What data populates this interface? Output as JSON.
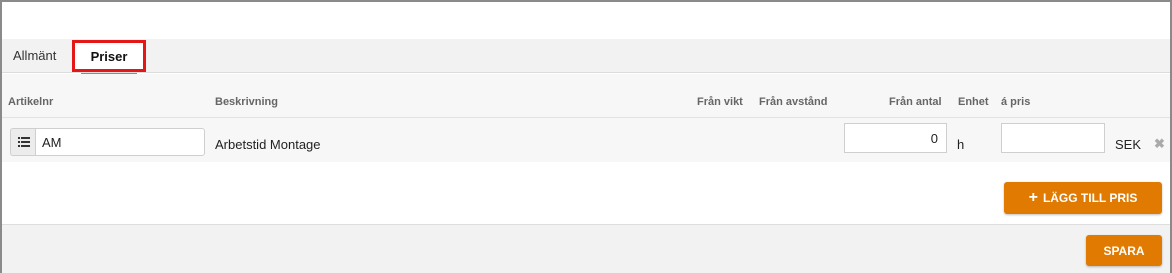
{
  "tabs": [
    {
      "label": "Allmänt",
      "active": false
    },
    {
      "label": "Priser",
      "active": true
    }
  ],
  "table": {
    "columns": [
      "Artikelnr",
      "Beskrivning",
      "Från vikt",
      "Från avstånd",
      "Från antal",
      "Enhet",
      "á pris"
    ],
    "rows": [
      {
        "article_nr": "AM",
        "description": "Arbetstid Montage",
        "from_quantity": "0",
        "unit": "h",
        "price": "",
        "currency": "SEK"
      }
    ]
  },
  "icons": {
    "list": "list-icon",
    "delete": "close-icon",
    "add": "plus-icon"
  },
  "buttons": {
    "add_price": "LÄGG TILL PRIS",
    "add_icon_glyph": "+",
    "delete_glyph": "✖",
    "save": "SPARA"
  },
  "colors": {
    "accent": "#e07a00",
    "highlight_border": "#e51616"
  }
}
